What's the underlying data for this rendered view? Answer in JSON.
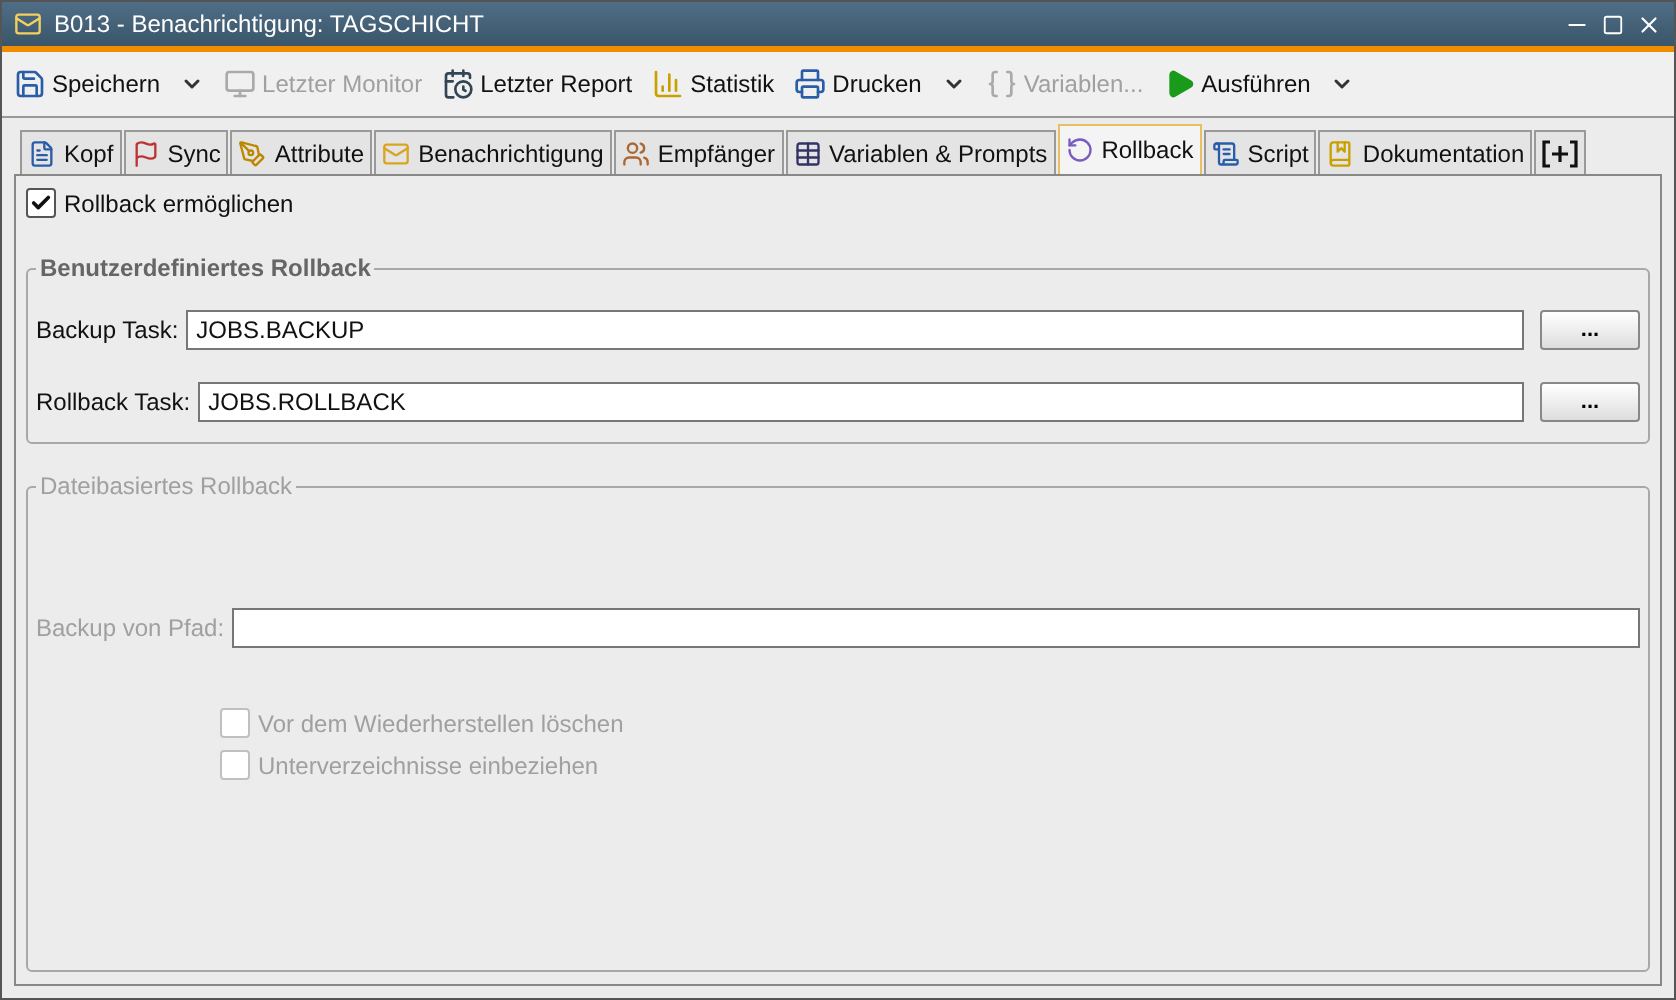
{
  "window": {
    "title": "B013 - Benachrichtigung: TAGSCHICHT"
  },
  "toolbar": [
    {
      "label": "Speichern",
      "disabled": false,
      "dropdown": true
    },
    {
      "label": "Letzter Monitor",
      "disabled": true,
      "dropdown": false
    },
    {
      "label": "Letzter Report",
      "disabled": false,
      "dropdown": false
    },
    {
      "label": "Statistik",
      "disabled": false,
      "dropdown": false
    },
    {
      "label": "Drucken",
      "disabled": false,
      "dropdown": true
    },
    {
      "label": "Variablen...",
      "disabled": true,
      "dropdown": false
    },
    {
      "label": "Ausführen",
      "disabled": false,
      "dropdown": true
    }
  ],
  "tabs": [
    {
      "label": "Kopf",
      "selected": false
    },
    {
      "label": "Sync",
      "selected": false
    },
    {
      "label": "Attribute",
      "selected": false
    },
    {
      "label": "Benachrichtigung",
      "selected": false
    },
    {
      "label": "Empfänger",
      "selected": false
    },
    {
      "label": "Variablen & Prompts",
      "selected": false
    },
    {
      "label": "Rollback",
      "selected": true
    },
    {
      "label": "Script",
      "selected": false
    },
    {
      "label": "Dokumentation",
      "selected": false
    }
  ],
  "enable_rollback": {
    "label": "Rollback ermöglichen",
    "checked": true
  },
  "groups": [
    {
      "title": "Benutzerdefiniertes Rollback",
      "disabled": false,
      "fields": [
        {
          "label": "Backup Task:",
          "value": "JOBS.BACKUP",
          "browse": "..."
        },
        {
          "label": "Rollback Task:",
          "value": "JOBS.ROLLBACK",
          "browse": "..."
        }
      ]
    },
    {
      "title": "Dateibasiertes Rollback",
      "disabled": true,
      "fields": [
        {
          "label": "Backup von Pfad:"
        }
      ],
      "checkboxes": [
        {
          "label": "Vor dem Wiederherstellen löschen",
          "checked": false
        },
        {
          "label": "Unterverzeichnisse einbeziehen",
          "checked": false
        }
      ]
    }
  ]
}
